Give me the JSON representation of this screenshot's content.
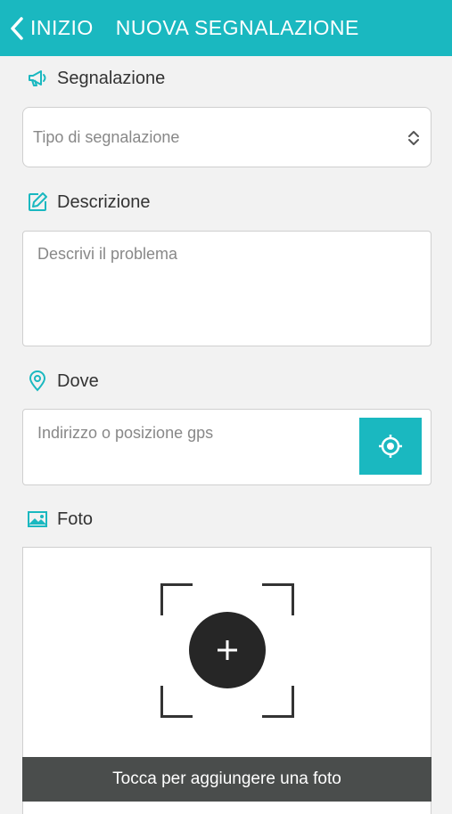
{
  "header": {
    "back_label": "INIZIO",
    "title": "NUOVA SEGNALAZIONE",
    "color": "#1ab8c0"
  },
  "segnalazione": {
    "label": "Segnalazione",
    "icon": "megaphone-icon",
    "select_placeholder": "Tipo di segnalazione"
  },
  "descrizione": {
    "label": "Descrizione",
    "icon": "edit-icon",
    "placeholder": "Descrivi il problema"
  },
  "dove": {
    "label": "Dove",
    "icon": "location-pin-icon",
    "placeholder": "Indirizzo o posizione gps",
    "gps_icon": "gps-target-icon"
  },
  "foto": {
    "label": "Foto",
    "icon": "image-icon",
    "add_icon": "plus-icon",
    "action_label": "Tocca per aggiungere una foto"
  }
}
